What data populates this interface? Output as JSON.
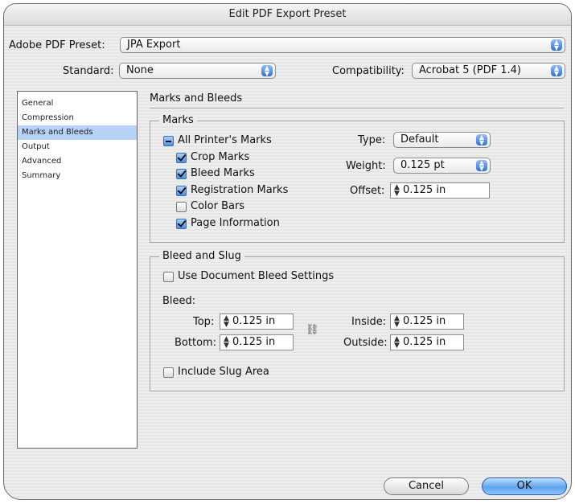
{
  "dialog": {
    "title": "Edit PDF Export Preset"
  },
  "preset": {
    "label": "Adobe PDF Preset:",
    "value": "JPA Export"
  },
  "standard": {
    "label": "Standard:",
    "value": "None"
  },
  "compatibility": {
    "label": "Compatibility:",
    "value": "Acrobat 5 (PDF 1.4)"
  },
  "sidebar": {
    "items": [
      {
        "label": "General"
      },
      {
        "label": "Compression"
      },
      {
        "label": "Marks and Bleeds",
        "selected": true
      },
      {
        "label": "Output"
      },
      {
        "label": "Advanced"
      },
      {
        "label": "Summary"
      }
    ]
  },
  "section": {
    "title": "Marks and Bleeds"
  },
  "marks": {
    "group_title": "Marks",
    "all_printers_marks": "All Printer's Marks",
    "crop_marks": "Crop Marks",
    "bleed_marks": "Bleed Marks",
    "registration_marks": "Registration Marks",
    "color_bars": "Color Bars",
    "page_information": "Page Information",
    "checked": {
      "all_printers_marks": "mixed",
      "crop_marks": true,
      "bleed_marks": true,
      "registration_marks": true,
      "color_bars": false,
      "page_information": true
    },
    "type_label": "Type:",
    "type_value": "Default",
    "weight_label": "Weight:",
    "weight_value": "0.125 pt",
    "offset_label": "Offset:",
    "offset_value": "0.125 in"
  },
  "bleed_slug": {
    "group_title": "Bleed and Slug",
    "use_document_bleed": "Use Document Bleed Settings",
    "use_document_bleed_checked": false,
    "bleed_label": "Bleed:",
    "top_label": "Top:",
    "top_value": "0.125 in",
    "bottom_label": "Bottom:",
    "bottom_value": "0.125 in",
    "inside_label": "Inside:",
    "inside_value": "0.125 in",
    "outside_label": "Outside:",
    "outside_value": "0.125 in",
    "include_slug": "Include Slug Area",
    "include_slug_checked": false
  },
  "buttons": {
    "cancel": "Cancel",
    "ok": "OK"
  },
  "colors": {
    "accent": "#4c8fe6",
    "selection": "#b6d3f7"
  }
}
